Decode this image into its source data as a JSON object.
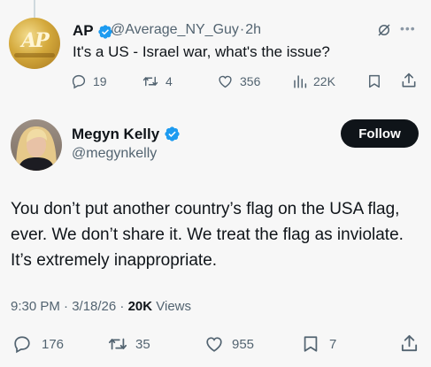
{
  "reply": {
    "author_name": "AP",
    "author_handle": "@Average_NY_Guy",
    "separator": "·",
    "time": "2h",
    "text": "It's a US - Israel war, what's the issue?",
    "replies": "19",
    "reposts": "4",
    "likes": "356",
    "views": "22K"
  },
  "tweet": {
    "author_name": "Megyn Kelly",
    "author_handle": "@megynkelly",
    "follow_label": "Follow",
    "text": "You don’t put another country’s flag on the USA flag, ever. We don’t share it. We treat the flag as inviolate. It’s extremely inappropriate.",
    "timestamp": "9:30 PM · 3/18/26 · ",
    "views_count": "20K",
    "views_label": " Views",
    "replies": "176",
    "reposts": "35",
    "likes": "955",
    "bookmarks": "7"
  },
  "colors": {
    "verified": "#1d9bf0",
    "text": "#0f1419",
    "muted": "#536471",
    "background": "#f7f7f7"
  },
  "icons": [
    "verified-badge-icon",
    "grok-icon",
    "more-icon",
    "reply-icon",
    "repost-icon",
    "like-icon",
    "views-icon",
    "bookmark-icon",
    "share-icon"
  ]
}
